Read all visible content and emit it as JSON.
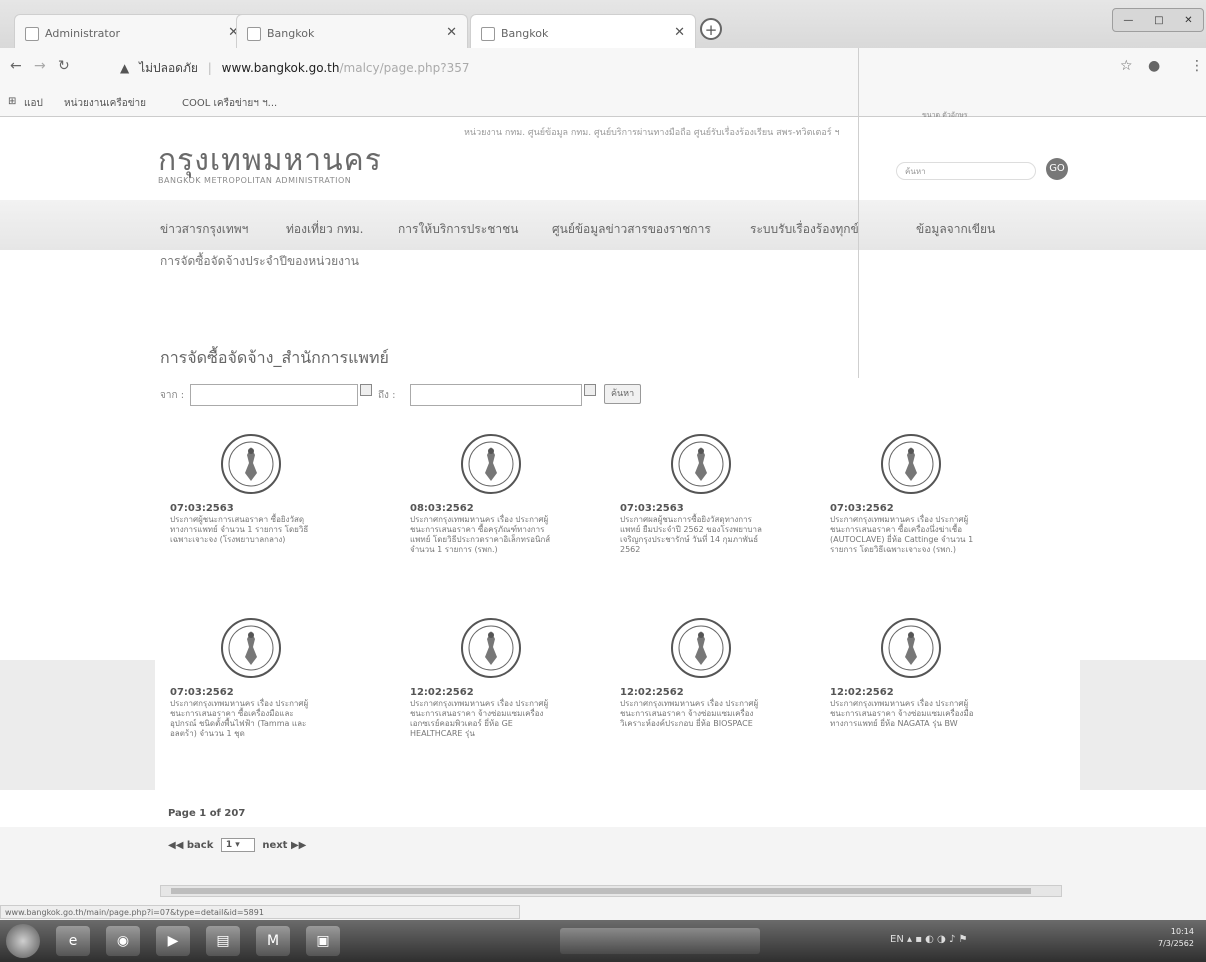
{
  "browser": {
    "tabs": [
      {
        "label": "Administrator"
      },
      {
        "label": "Bangkok"
      },
      {
        "label": "Bangkok"
      }
    ],
    "address": {
      "security": "ไม่ปลอดภัย",
      "host": "www.bangkok.go.th",
      "path": "/malcy/page.php?357"
    },
    "bookmarks": [
      "แอป",
      "หน่วยงานเครือข่าย",
      "COOL เครือข่ายฯ ฯ..."
    ]
  },
  "site": {
    "brand_title": "กรุงเทพมหานคร",
    "brand_sub": "BANGKOK METROPOLITAN ADMINISTRATION",
    "top_links": "หน่วยงาน กทม. ศูนย์ข้อมูล กทม. ศูนย์บริการผ่านทางมือถือ ศูนย์รับเรื่องร้องเรียน สพร-ทวิตเตอร์ ฯ",
    "util_links": "ขนาด ตัวอักษร",
    "search_placeholder": "ค้นหา",
    "search_button": "GO",
    "nav": [
      "ข่าวสารกรุงเทพฯ",
      "ท่องเที่ยว กทม.",
      "การให้บริการประชาชน",
      "ศูนย์ข้อมูลข่าวสารของราชการ",
      "ระบบรับเรื่องร้องทุกข์",
      "ข้อมูลจากเขียน"
    ],
    "breadcrumb": "การจัดซื้อจัดจ้างประจำปีของหน่วยงาน"
  },
  "main": {
    "section_title": "การจัดซื้อจัดจ้าง_สำนักการแพทย์",
    "filter": {
      "from_label": "จาก :",
      "to_label": "ถึง :",
      "from_value": "",
      "to_value": "",
      "search_button": "ค้นหา"
    },
    "cards": [
      {
        "date": "07:03:2563",
        "desc": "ประกาศผู้ชนะการเสนอราคา ซื้อยิงวัสดุ ทางการแพทย์ จำนวน 1 รายการ โดยวิธีเฉพาะเจาะจง (โรงพยาบาลกลาง)"
      },
      {
        "date": "08:03:2562",
        "desc": "ประกาศกรุงเทพมหานคร เรื่อง ประกาศผู้ชนะการเสนอราคา ซื้อครุภัณฑ์ทางการแพทย์ โดยวิธีประกวดราคาอิเล็กทรอนิกส์ จำนวน 1 รายการ (รพก.)"
      },
      {
        "date": "07:03:2563",
        "desc": "ประกาศผลผู้ชนะการซื้อยิงวัสดุทางการแพทย์ ยืมประจำปี 2562 ของโรงพยาบาลเจริญกรุงประชารักษ์ วันที่ 14 กุมภาพันธ์ 2562"
      },
      {
        "date": "07:03:2562",
        "desc": "ประกาศกรุงเทพมหานคร เรื่อง ประกาศผู้ชนะการเสนอราคา ซื้อเครื่องนึ่งฆ่าเชื้อ (AUTOCLAVE) ยี่ห้อ Cattinge จำนวน 1 รายการ โดยวิธีเฉพาะเจาะจง (รพก.)"
      },
      {
        "date": "07:03:2562",
        "desc": "ประกาศกรุงเทพมหานคร เรื่อง ประกาศผู้ชนะการเสนอราคา ซื้อเครื่องมือและอุปกรณ์ ชนิดตั้งพื้นไฟฟ้า (Tamma และ อลตร้า) จำนวน 1 ชุด"
      },
      {
        "date": "12:02:2562",
        "desc": "ประกาศกรุงเทพมหานคร เรื่อง ประกาศผู้ชนะการเสนอราคา จ้างซ่อมแซมเครื่องเอกซเรย์คอมพิวเตอร์ ยี่ห้อ GE HEALTHCARE รุ่น"
      },
      {
        "date": "12:02:2562",
        "desc": "ประกาศกรุงเทพมหานคร เรื่อง ประกาศผู้ชนะการเสนอราคา จ้างซ่อมแซมเครื่องวิเคราะห์องค์ประกอบ ยี่ห้อ BIOSPACE"
      },
      {
        "date": "12:02:2562",
        "desc": "ประกาศกรุงเทพมหานคร เรื่อง ประกาศผู้ชนะการเสนอราคา จ้างซ่อมแซมเครื่องมือทางการแพทย์ ยี่ห้อ NAGATA รุ่น BW"
      }
    ],
    "pagination": {
      "label": "Page",
      "current": "1",
      "of": "of",
      "total": "207"
    },
    "pager": {
      "back": "◀◀ back",
      "page_value": "1",
      "next": "next ▶▶"
    }
  },
  "status_url": "www.bangkok.go.th/main/page.php?i=07&type=detail&id=5891",
  "taskbar": {
    "tray_text": "EN",
    "time": "10:14",
    "date": "7/3/2562"
  }
}
